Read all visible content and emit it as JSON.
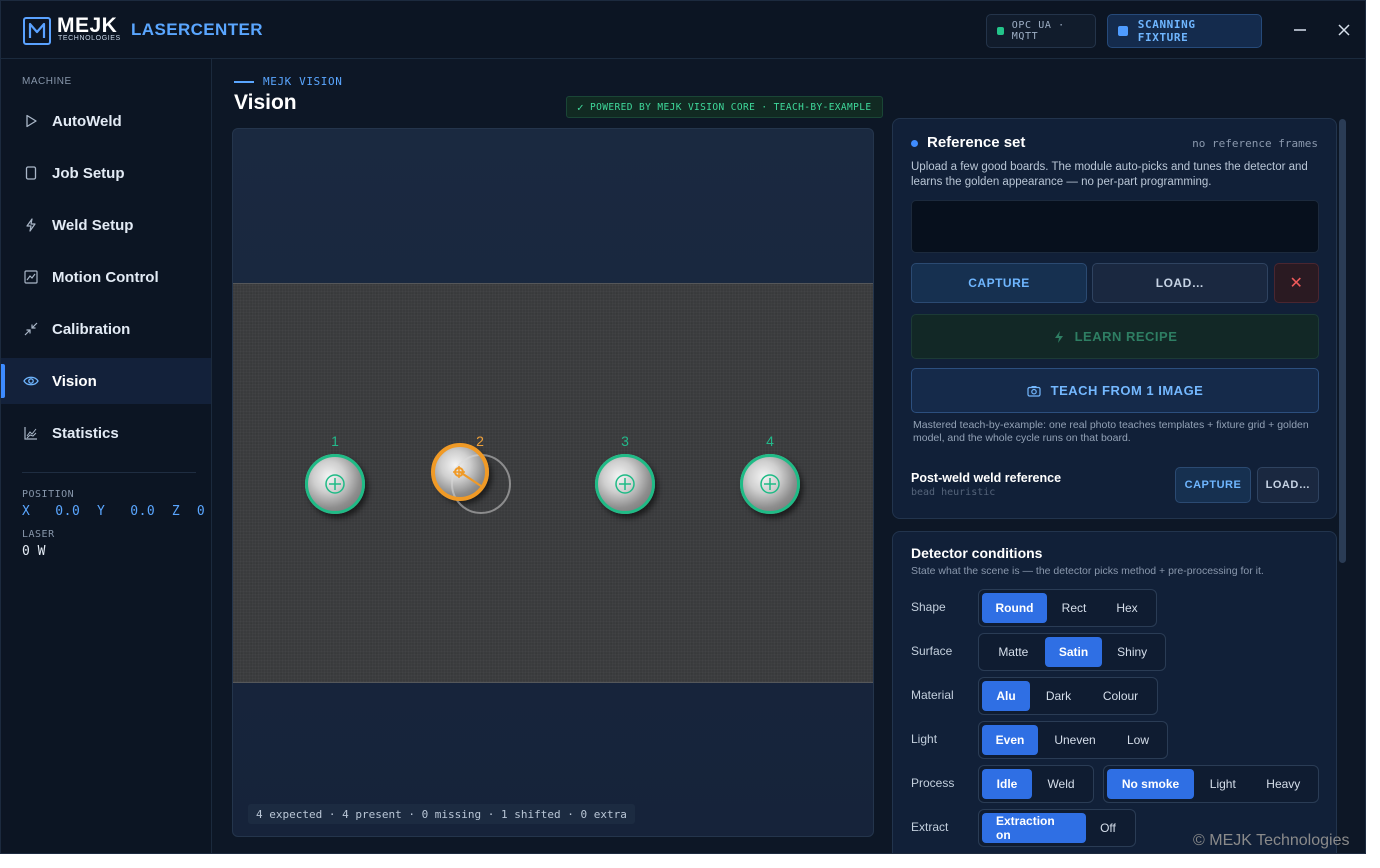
{
  "titlebar": {
    "logo_word": "MEJK",
    "logo_sub": "TECHNOLOGIES",
    "app_name": "LASERCENTER",
    "opc_status": "OPC UA · MQTT",
    "scan_status": "SCANNING FIXTURE",
    "minimize_label": "—",
    "close_label": "✕"
  },
  "sidebar": {
    "section": "MACHINE",
    "items": [
      {
        "label": "AutoWeld",
        "icon": "play-icon"
      },
      {
        "label": "Job Setup",
        "icon": "document-icon"
      },
      {
        "label": "Weld Setup",
        "icon": "bolt-icon"
      },
      {
        "label": "Motion Control",
        "icon": "chart-icon"
      },
      {
        "label": "Calibration",
        "icon": "collapse-arrows-icon"
      },
      {
        "label": "Vision",
        "icon": "eye-icon",
        "active": true
      },
      {
        "label": "Statistics",
        "icon": "statistics-icon"
      }
    ],
    "position_label": "POSITION",
    "position_value": "X   0.0  Y   0.0  Z  0",
    "laser_label": "LASER",
    "laser_value": "0 W"
  },
  "main": {
    "breadcrumb": "MEJK VISION",
    "title": "Vision",
    "powered": "POWERED BY MEJK VISION CORE · TEACH-BY-EXAMPLE",
    "studs": [
      "1",
      "2",
      "3",
      "4"
    ],
    "status": "4 expected · 4 present · 0 missing · 1 shifted · 0 extra"
  },
  "reference": {
    "title": "Reference set",
    "meta": "no reference frames",
    "description": "Upload a few good boards. The module auto-picks and tunes the detector and learns the golden appearance — no per-part programming.",
    "capture": "CAPTURE",
    "load": "LOAD…",
    "clear": "✕",
    "learn": "LEARN RECIPE",
    "teach": "TEACH FROM 1 IMAGE",
    "note": "Mastered teach-by-example: one real photo teaches templates + fixture grid + golden model, and the whole cycle runs on that board.",
    "postweld_title": "Post-weld weld reference",
    "postweld_sub": "bead heuristic",
    "postweld_capture": "CAPTURE",
    "postweld_load": "LOAD…"
  },
  "detector": {
    "title": "Detector conditions",
    "subtitle": "State what the scene is — the detector picks method + pre-processing for it.",
    "shape": {
      "label": "Shape",
      "options": [
        "Round",
        "Rect",
        "Hex"
      ],
      "selected": "Round"
    },
    "surface": {
      "label": "Surface",
      "options": [
        "Matte",
        "Satin",
        "Shiny"
      ],
      "selected": "Satin"
    },
    "material": {
      "label": "Material",
      "options": [
        "Alu",
        "Dark",
        "Colour"
      ],
      "selected": "Alu"
    },
    "light": {
      "label": "Light",
      "options": [
        "Even",
        "Uneven",
        "Low"
      ],
      "selected": "Even"
    },
    "process": {
      "label": "Process",
      "options": [
        "Idle",
        "Weld"
      ],
      "selected": "Idle",
      "smoke_options": [
        "No smoke",
        "Light",
        "Heavy"
      ],
      "smoke_selected": "No smoke"
    },
    "extract": {
      "label": "Extract",
      "options": [
        "Extraction on",
        "Off"
      ],
      "selected": "Extraction on"
    }
  },
  "footer": {
    "copyright": "© MEJK Technologies"
  },
  "colors": {
    "accent": "#3d8bff",
    "ok": "#1fbb86",
    "warn": "#f09a26",
    "bg": "#0d1726"
  }
}
